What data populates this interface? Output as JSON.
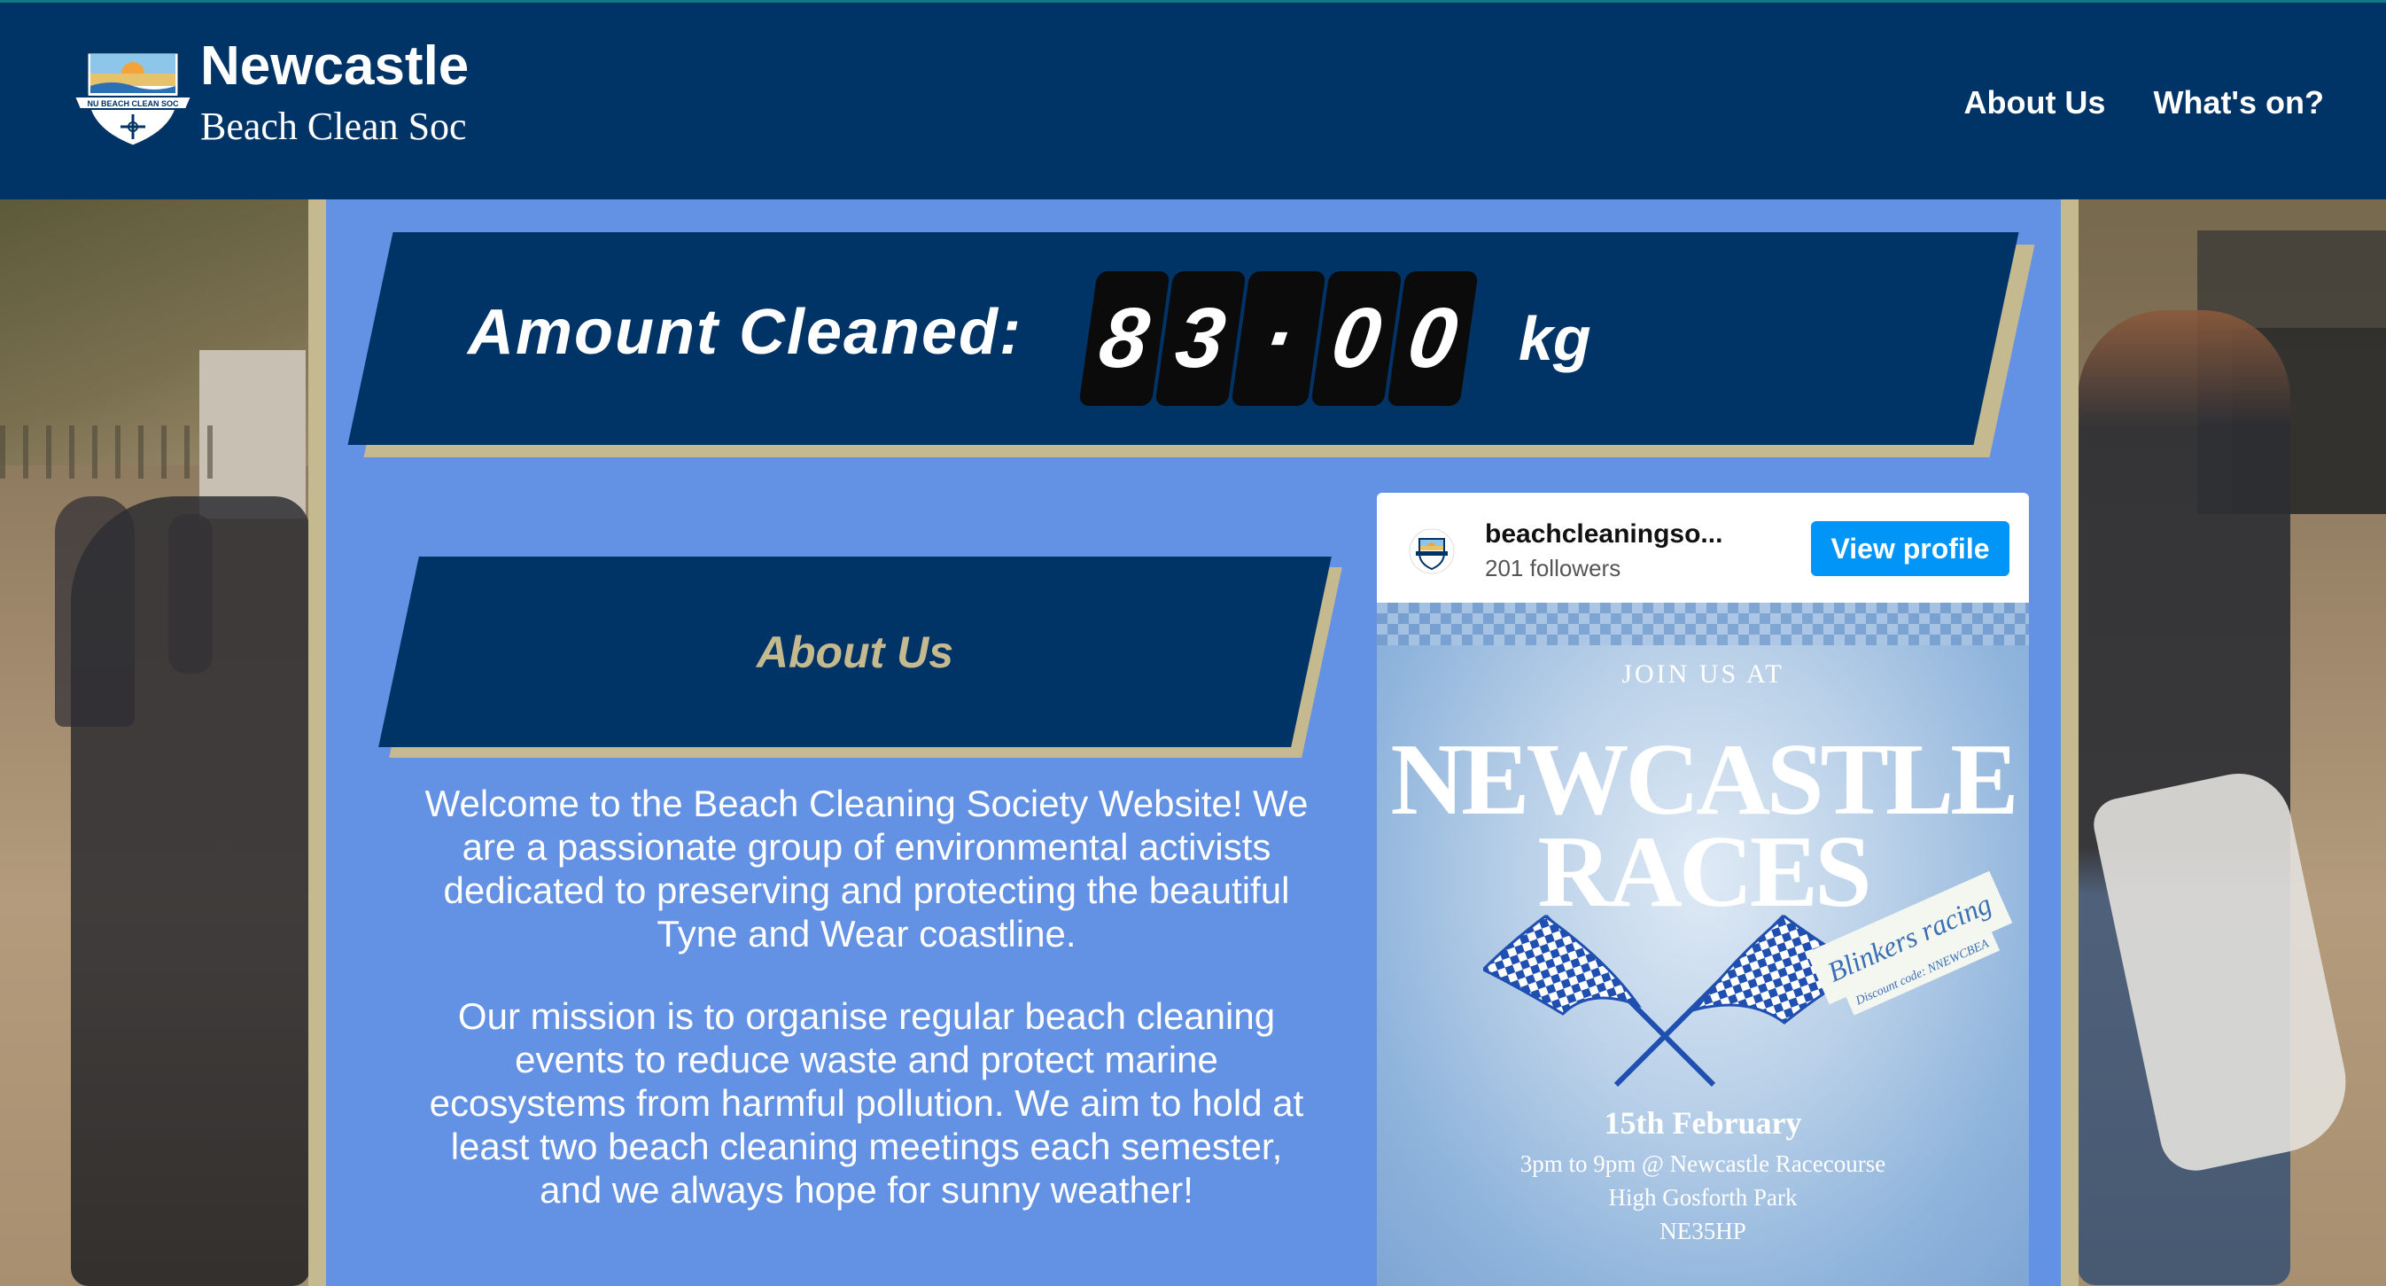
{
  "header": {
    "brand_title": "Newcastle",
    "brand_subtitle": "Beach Clean Soc",
    "logo_text": "NU BEACH CLEAN SOC",
    "nav": [
      {
        "label": "About Us"
      },
      {
        "label": "What's on?"
      }
    ],
    "colors": {
      "background": "#003366",
      "text": "#ffffff"
    }
  },
  "counter": {
    "label": "Amount Cleaned:",
    "digits": [
      "8",
      "3",
      "·",
      "0",
      "0"
    ],
    "unit": "kg"
  },
  "about": {
    "title": "About Us",
    "paragraphs": [
      "Welcome to the Beach Cleaning Society Website! We are a passionate group of environmental activists dedicated to preserving and protecting the beautiful Tyne and Wear coastline.",
      "Our mission is to organise regular beach cleaning events to reduce waste and protect marine ecosystems from harmful pollution. We aim to hold at least two beach cleaning meetings each semester, and we always hope for sunny weather!"
    ]
  },
  "instagram": {
    "username": "beachcleaningso...",
    "followers": "201 followers",
    "button": "View profile",
    "post": {
      "join": "JOIN US AT",
      "line1": "NEWCASTLE",
      "line2": "RACES",
      "tag": "Blinkers racing",
      "discount": "Discount code: NNEWCBEA",
      "date": "15th February",
      "time_place": "3pm to 9pm @ Newcastle Racecourse",
      "location": "High Gosforth Park",
      "postcode": "NE35HP"
    }
  },
  "colors": {
    "navy": "#003366",
    "gold": "#c5b990",
    "panel_blue": "#6391e4",
    "ig_button": "#0095f6"
  }
}
